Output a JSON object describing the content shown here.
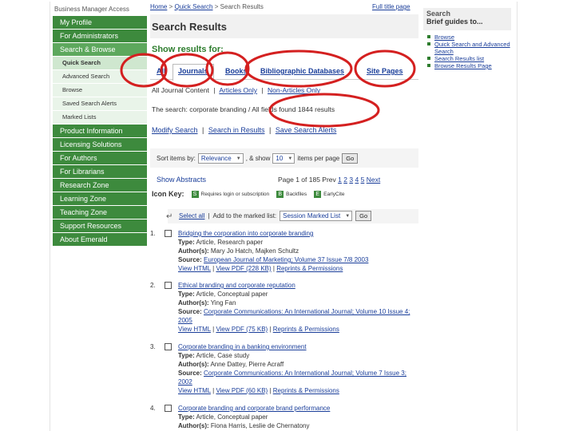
{
  "sidebar": {
    "header": "Business Manager Access",
    "items": [
      {
        "label": "My Profile"
      },
      {
        "label": "For Administrators"
      },
      {
        "label": "Search & Browse"
      }
    ],
    "subitems": [
      {
        "label": "Quick Search"
      },
      {
        "label": "Advanced Search"
      },
      {
        "label": "Browse"
      },
      {
        "label": "Saved Search Alerts"
      },
      {
        "label": "Marked Lists"
      }
    ],
    "items_after": [
      {
        "label": "Product Information"
      },
      {
        "label": "Licensing Solutions"
      },
      {
        "label": "For Authors"
      },
      {
        "label": "For Librarians"
      },
      {
        "label": "Research Zone"
      },
      {
        "label": "Learning Zone"
      },
      {
        "label": "Teaching Zone"
      },
      {
        "label": "Support Resources"
      },
      {
        "label": "About Emerald"
      }
    ]
  },
  "breadcrumb": {
    "home": "Home",
    "quick": "Quick Search",
    "current": "Search Results",
    "sep": ">"
  },
  "full_title_link": "Full title page",
  "page_title": "Search Results",
  "show_for": "Show results for:",
  "tabs": [
    {
      "label": "All"
    },
    {
      "label": "Journals"
    },
    {
      "label": "Books"
    },
    {
      "label": "Bibliographic Databases"
    },
    {
      "label": "Site Pages"
    }
  ],
  "subtabs": {
    "all": "All Journal Content",
    "articles": "Articles Only",
    "non": "Non-Articles Only"
  },
  "summary": "The search: corporate branding / All fields found 1844 results",
  "actions": {
    "modify": "Modify Search",
    "within": "Search in Results",
    "save": "Save Search Alerts"
  },
  "sort": {
    "label": "Sort items by:",
    "value": "Relevance",
    "show_label": ", & show",
    "count": "10",
    "per_page": "items per page",
    "go": "Go"
  },
  "abstracts": "Show Abstracts",
  "pager": {
    "text": "Page 1 of 185  Prev",
    "pages": [
      "1",
      "2",
      "3",
      "4",
      "5"
    ],
    "next": "Next"
  },
  "icon_key": {
    "title": "Icon Key:",
    "items": [
      {
        "glyph": "S",
        "label": "Requires login or subscription"
      },
      {
        "glyph": "B",
        "label": "Backfiles"
      },
      {
        "glyph": "E",
        "label": "EarlyCite"
      }
    ]
  },
  "marked": {
    "select_all": "Select all",
    "add_label": "Add to the marked list:",
    "list_value": "Session Marked List",
    "go": "Go"
  },
  "results": [
    {
      "num": "1.",
      "title": "Bridging the corporation into corporate branding",
      "type": "Article, Research paper",
      "authors": "Mary Jo Hatch, Majken Schultz",
      "source": "European Journal of Marketing; Volume 37 Issue 7/8 2003",
      "links": [
        "View HTML",
        "View PDF (228 KB)",
        "Reprints & Permissions"
      ]
    },
    {
      "num": "2.",
      "title": "Ethical branding and corporate reputation",
      "type": "Article, Conceptual paper",
      "authors": "Ying Fan",
      "source": "Corporate Communications: An International Journal; Volume 10 Issue 4; 2005",
      "links": [
        "View HTML",
        "View PDF (75 KB)",
        "Reprints & Permissions"
      ]
    },
    {
      "num": "3.",
      "title": "Corporate branding in a banking environment",
      "type": "Article, Case study",
      "authors": "Anne Dattey, Pierre Acraff",
      "source": "Corporate Communications: An International Journal; Volume 7 Issue 3; 2002",
      "links": [
        "View HTML",
        "View PDF (60 KB)",
        "Reprints & Permissions"
      ]
    },
    {
      "num": "4.",
      "title": "Corporate branding and corporate brand performance",
      "type": "Article, Conceptual paper",
      "authors": "Fiona Harris, Leslie de Chernatony",
      "source": "",
      "links": []
    }
  ],
  "labels": {
    "type": "Type:",
    "authors": "Author(s):",
    "source": "Source:"
  },
  "right_panel": {
    "title": "Search",
    "subtitle": "Brief guides to...",
    "items": [
      {
        "label": "Browse"
      },
      {
        "label": "Quick Search and Advanced Search"
      },
      {
        "label": "Search Results list"
      },
      {
        "label": "Browse Results Page"
      }
    ]
  },
  "colors": {
    "nav_green": "#3d8a3d",
    "link_blue": "#1a3e9a",
    "annotation_red": "#d42020"
  }
}
